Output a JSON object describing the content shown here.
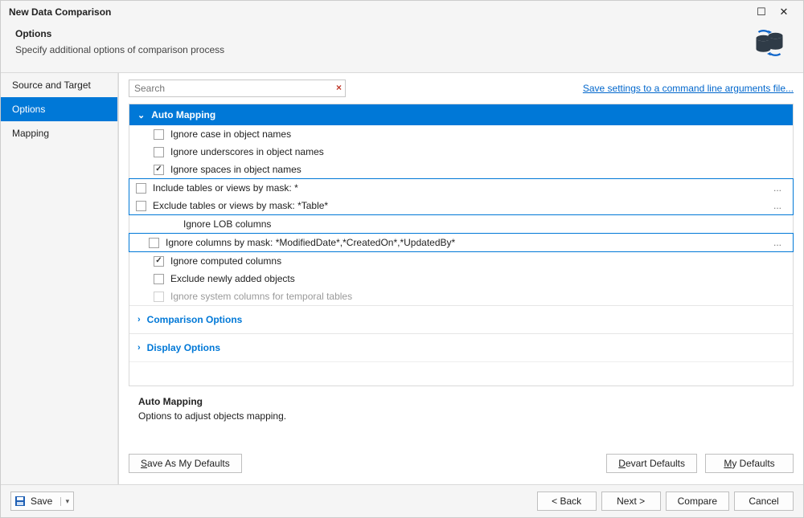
{
  "window": {
    "title": "New Data Comparison"
  },
  "header": {
    "title": "Options",
    "subtitle": "Specify additional options of comparison process"
  },
  "sidebar": {
    "items": [
      {
        "label": "Source and Target"
      },
      {
        "label": "Options"
      },
      {
        "label": "Mapping"
      }
    ]
  },
  "search": {
    "placeholder": "Search"
  },
  "link_save_cmd": "Save settings to a command line arguments file...",
  "sections": {
    "auto_mapping": {
      "title": "Auto Mapping",
      "opts": {
        "ignore_case": "Ignore case in object names",
        "ignore_underscores": "Ignore underscores in object names",
        "ignore_spaces": "Ignore spaces in object names",
        "include_mask": "Include tables or views by mask: *",
        "exclude_mask": "Exclude tables or views by mask: *Table*",
        "ignore_lob": "Ignore LOB columns",
        "ignore_cols_mask": "Ignore columns by mask: *ModifiedDate*,*CreatedOn*,*UpdatedBy*",
        "ignore_computed": "Ignore computed columns",
        "exclude_new": "Exclude newly added objects",
        "ignore_temporal": "Ignore system columns for temporal tables"
      }
    },
    "comparison": {
      "title": "Comparison Options"
    },
    "display": {
      "title": "Display Options"
    }
  },
  "description": {
    "title": "Auto Mapping",
    "text": "Options to adjust objects mapping."
  },
  "defaults": {
    "save_as": "Save As My Defaults",
    "devart": "Devart Defaults",
    "my": "My Defaults"
  },
  "bottom": {
    "save": "Save",
    "back": "< Back",
    "next": "Next >",
    "compare": "Compare",
    "cancel": "Cancel"
  },
  "ellipsis": "..."
}
